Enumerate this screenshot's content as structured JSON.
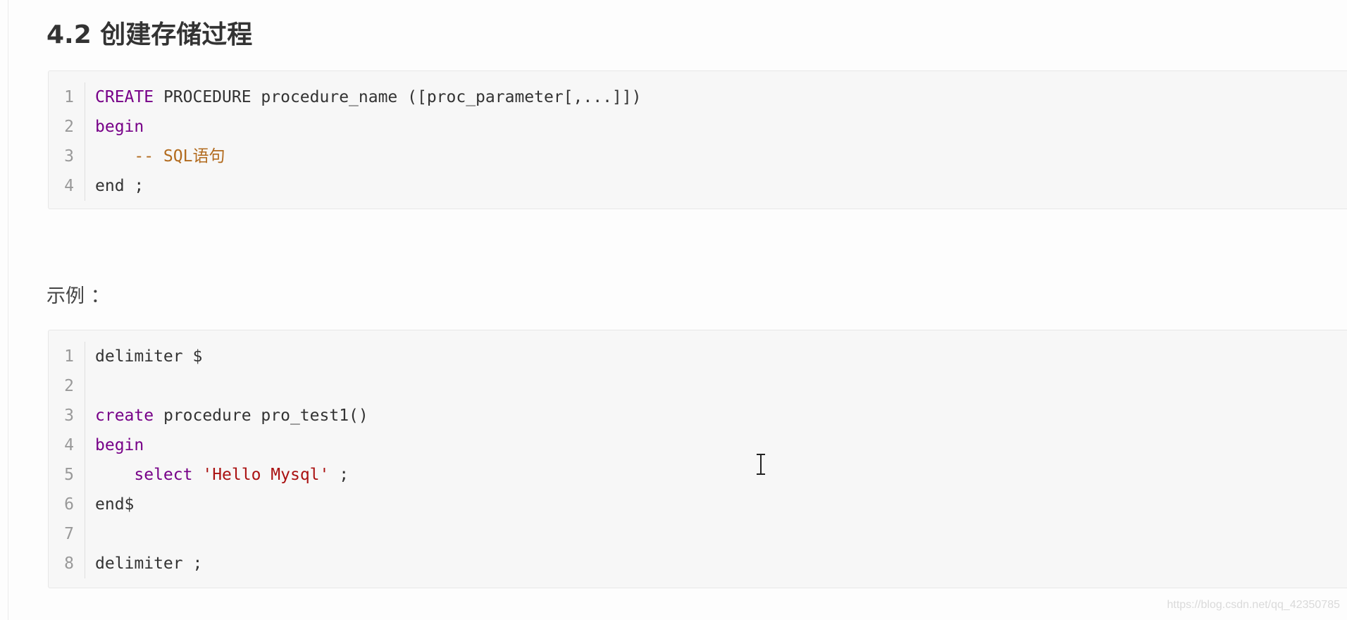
{
  "faint_top_text": "...",
  "heading": "4.2 创建存储过程",
  "syntax_block": {
    "lines": [
      {
        "n": "1",
        "tokens": [
          {
            "t": "CREATE",
            "c": "kw"
          },
          {
            "t": " PROCEDURE procedure_name ([proc_parameter[,...]])",
            "c": ""
          }
        ]
      },
      {
        "n": "2",
        "tokens": [
          {
            "t": "begin",
            "c": "kw"
          }
        ]
      },
      {
        "n": "3",
        "tokens": [
          {
            "t": "    ",
            "c": ""
          },
          {
            "t": "-- SQL语句",
            "c": "cm"
          }
        ]
      },
      {
        "n": "4",
        "tokens": [
          {
            "t": "end ;",
            "c": ""
          }
        ]
      }
    ]
  },
  "example_label": "示例 ：",
  "example_block": {
    "lines": [
      {
        "n": "1",
        "tokens": [
          {
            "t": "delimiter $",
            "c": ""
          }
        ]
      },
      {
        "n": "2",
        "tokens": []
      },
      {
        "n": "3",
        "tokens": [
          {
            "t": "create",
            "c": "kw"
          },
          {
            "t": " procedure pro_test1()",
            "c": ""
          }
        ]
      },
      {
        "n": "4",
        "tokens": [
          {
            "t": "begin",
            "c": "kw"
          }
        ]
      },
      {
        "n": "5",
        "tokens": [
          {
            "t": "    ",
            "c": ""
          },
          {
            "t": "select",
            "c": "kw"
          },
          {
            "t": " ",
            "c": ""
          },
          {
            "t": "'Hello Mysql'",
            "c": "str"
          },
          {
            "t": " ;",
            "c": ""
          }
        ]
      },
      {
        "n": "6",
        "tokens": [
          {
            "t": "end$",
            "c": ""
          }
        ]
      },
      {
        "n": "7",
        "tokens": []
      },
      {
        "n": "8",
        "tokens": [
          {
            "t": "delimiter ;",
            "c": ""
          }
        ]
      }
    ]
  },
  "watermark": "https://blog.csdn.net/qq_42350785",
  "colors": {
    "keyword": "#770088",
    "string": "#aa1111",
    "comment": "#b26b1e",
    "text": "#333333",
    "line_number": "#999999",
    "code_background": "#f7f7f7"
  }
}
